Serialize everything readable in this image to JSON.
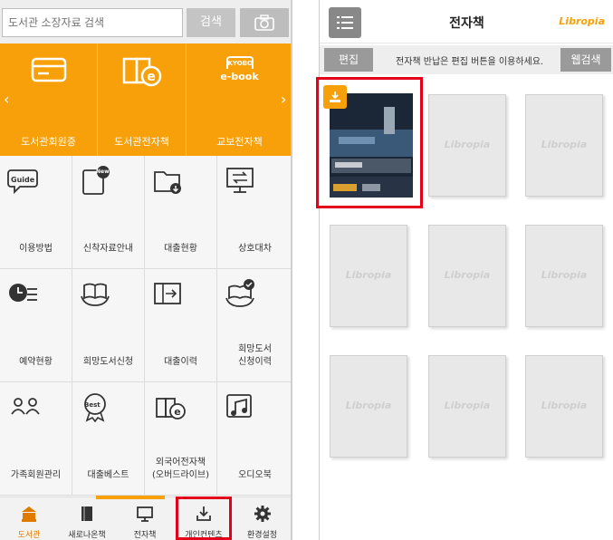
{
  "left": {
    "search": {
      "placeholder": "도서관 소장자료 검색",
      "button_label": "검색",
      "camera_icon": "camera-icon"
    },
    "banner": [
      {
        "label": "도서관회원증",
        "icon": "membership-card-icon"
      },
      {
        "label": "도서관전자책",
        "icon": "library-ebook-icon"
      },
      {
        "label": "교보전자책",
        "icon": "kyobo-ebook-icon",
        "icon_text_top": "KYOBO",
        "icon_text_bottom": "e-book"
      }
    ],
    "grid": [
      {
        "label": "이용방법",
        "icon": "guide-icon",
        "icon_text": "Guide"
      },
      {
        "label": "신착자료안내",
        "icon": "new-arrivals-icon",
        "icon_text": "New"
      },
      {
        "label": "대출현황",
        "icon": "loan-status-icon"
      },
      {
        "label": "상호대차",
        "icon": "interlibrary-loan-icon"
      },
      {
        "label": "예약현황",
        "icon": "reservation-status-icon"
      },
      {
        "label": "희망도서신청",
        "icon": "book-request-icon"
      },
      {
        "label": "대출이력",
        "icon": "loan-history-icon"
      },
      {
        "label_line1": "희망도서",
        "label_line2": "신청이력",
        "icon": "request-history-icon"
      },
      {
        "label": "가족회원관리",
        "icon": "family-members-icon"
      },
      {
        "label": "대출베스트",
        "icon": "best-loans-icon",
        "icon_text": "Best"
      },
      {
        "label_line1": "외국어전자책",
        "label_line2": "(오버드라이브)",
        "icon": "foreign-ebook-icon"
      },
      {
        "label": "오디오북",
        "icon": "audiobook-icon"
      }
    ],
    "tabs": [
      {
        "label": "도서관",
        "icon": "library-icon",
        "active": true
      },
      {
        "label": "새로나온책",
        "icon": "new-books-icon",
        "active": false
      },
      {
        "label": "전자책",
        "icon": "ebook-monitor-icon",
        "active": false
      },
      {
        "label": "개인컨텐츠",
        "icon": "personal-content-icon",
        "active": false
      },
      {
        "label": "환경설정",
        "icon": "gear-icon",
        "active": false
      }
    ]
  },
  "right": {
    "title": "전자책",
    "brand": "Libropia",
    "edit_label": "편집",
    "hint": "전자책 반납은 편집 버튼을 이용하세요.",
    "web_search_label": "웹검색",
    "placeholder_label": "Libropia",
    "books": [
      {
        "label": "Libropia"
      },
      {
        "label": "Libropia"
      },
      {
        "label": "Libropia"
      },
      {
        "label": "Libropia"
      },
      {
        "label": "Libropia"
      },
      {
        "label": "Libropia"
      },
      {
        "label": "Libropia"
      },
      {
        "label": "Libropia"
      }
    ]
  },
  "colors": {
    "accent": "#f7a00a",
    "highlight": "#e4001b"
  }
}
